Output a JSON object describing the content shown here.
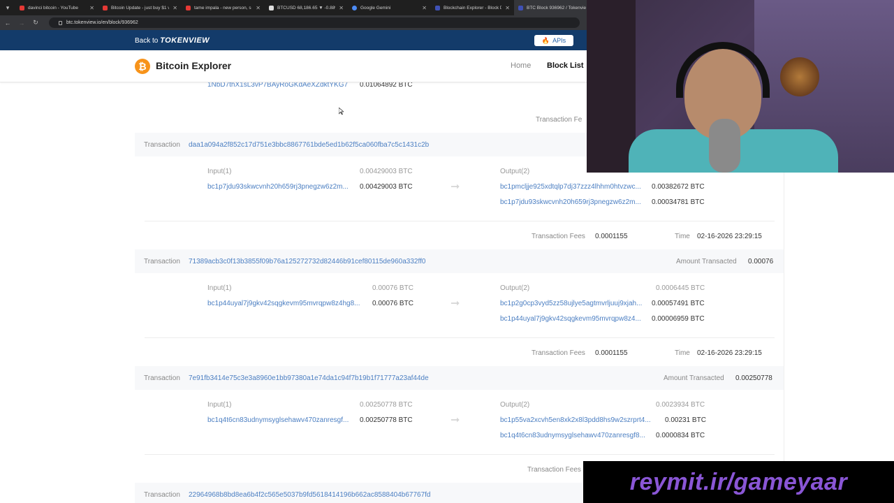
{
  "browser": {
    "tabs": [
      {
        "title": "davinci bitcoin - YouTube",
        "color": "#e53935",
        "active": false
      },
      {
        "title": "Bitcoin Update - just buy $1 v",
        "color": "#e53935",
        "active": false
      },
      {
        "title": "tame impala - new person, s",
        "color": "#e53935",
        "active": false
      },
      {
        "title": "BTCUSD 68,186.65 ▼ -0.88%",
        "color": "#dddddd",
        "active": false
      },
      {
        "title": "Google Gemini",
        "color": "#4c8bf5",
        "active": false
      },
      {
        "title": "Blockchain Explorer - Block D",
        "color": "#3f51b5",
        "active": false
      },
      {
        "title": "BTC Block 936962 / Tokenvie",
        "color": "#3f51b5",
        "active": true
      }
    ],
    "url": "btc.tokenview.io/en/block/936962"
  },
  "header": {
    "back_prefix": "Back to",
    "back_brand": "TOKENVIEW",
    "apis_label": "APIs"
  },
  "navbar": {
    "logo_glyph": "₿",
    "brand": "Bitcoin Explorer",
    "home": "Home",
    "block_list": "Block List"
  },
  "partial": {
    "output_address": "1NbD7thX1sL3vP7BAyRoGKdAeXZdktYKG7",
    "output_amount": "0.01064892 BTC",
    "fees_label": "Transaction Fe"
  },
  "labels": {
    "transaction": "Transaction",
    "fees": "Transaction Fees",
    "time": "Time",
    "amount_transacted": "Amount Transacted",
    "arrow": "➞"
  },
  "transactions": [
    {
      "hash": "daa1a094a2f852c17d751e3bbc8867761bde5ed1b62f5ca060fba7c5c1431c2b",
      "input_header": "Input(1)",
      "input_total": "0.00429003 BTC",
      "inputs": [
        {
          "address": "bc1p7jdu93skwcvnh20h659rj3pnegzw6z2m...",
          "amount": "0.00429003 BTC"
        }
      ],
      "output_header": "Output(2)",
      "outputs": [
        {
          "address": "bc1pmcljje925xdtqlp7dj37zzz4lhhm0htvzwc...",
          "amount": "0.00382672 BTC"
        },
        {
          "address": "bc1p7jdu93skwcvnh20h659rj3pnegzw6z2m...",
          "amount": "0.00034781 BTC"
        }
      ],
      "fees": "0.0001155",
      "time": "02-16-2026 23:29:15"
    },
    {
      "hash": "71389acb3c0f13b3855f09b76a125272732d82446b91cef80115de960a332ff0",
      "amount_transacted": "0.00076",
      "input_header": "Input(1)",
      "input_total": "0.00076 BTC",
      "inputs": [
        {
          "address": "bc1p44uyal7j9gkv42sqgkevm95mvrqpw8z4hg8...",
          "amount": "0.00076 BTC"
        }
      ],
      "output_header": "Output(2)",
      "output_total": "0.0006445 BTC",
      "outputs": [
        {
          "address": "bc1p2g0cp3vyd5zz58ujlye5agtmvrljuuj9xjah...",
          "amount": "0.00057491 BTC"
        },
        {
          "address": "bc1p44uyal7j9gkv42sqgkevm95mvrqpw8z4...",
          "amount": "0.00006959 BTC"
        }
      ],
      "fees": "0.0001155",
      "time": "02-16-2026 23:29:15"
    },
    {
      "hash": "7e91fb3414e75c3e3a8960e1bb97380a1e74da1c94f7b19b1f71777a23af44de",
      "amount_transacted": "0.00250778",
      "input_header": "Input(1)",
      "input_total": "0.00250778 BTC",
      "inputs": [
        {
          "address": "bc1q4t6cn83udnymsyglsehawv470zanresgf...",
          "amount": "0.00250778 BTC"
        }
      ],
      "output_header": "Output(2)",
      "output_total": "0.0023934 BTC",
      "outputs": [
        {
          "address": "bc1p55va2xcvh5en8xk2x8l3pdd8hs9w2szrprt4...",
          "amount": "0.00231 BTC"
        },
        {
          "address": "bc1q4t6cn83udnymsyglsehawv470zanresgf8...",
          "amount": "0.0000834 BTC"
        }
      ],
      "fees_partial": "Transaction Fees"
    },
    {
      "hash": "22964968b8bd8ea6b4f2c565e5037b9fd5618414196b662ac8588404b67767fd"
    }
  ],
  "banner": {
    "text": "reymit.ir/gameyaar"
  }
}
